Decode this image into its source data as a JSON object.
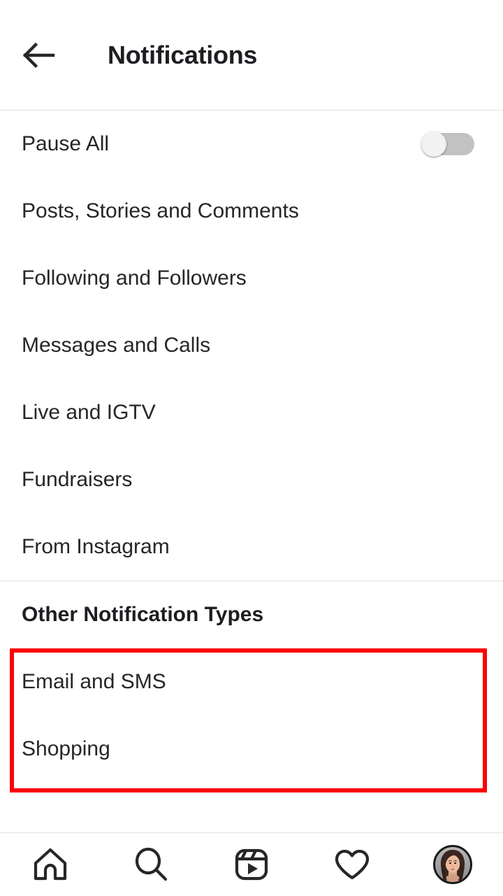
{
  "header": {
    "back_icon": "arrow-left-icon",
    "title": "Notifications"
  },
  "main_section": {
    "items": [
      {
        "label": "Pause All",
        "control": "toggle",
        "toggle_state": "off"
      },
      {
        "label": "Posts, Stories and Comments",
        "control": "none"
      },
      {
        "label": "Following and Followers",
        "control": "none"
      },
      {
        "label": "Messages and Calls",
        "control": "none"
      },
      {
        "label": "Live and IGTV",
        "control": "none"
      },
      {
        "label": "Fundraisers",
        "control": "none"
      },
      {
        "label": "From Instagram",
        "control": "none"
      }
    ]
  },
  "other_section": {
    "heading": "Other Notification Types",
    "items": [
      {
        "label": "Email and SMS"
      },
      {
        "label": "Shopping"
      }
    ]
  },
  "annotation": {
    "type": "highlight-rectangle",
    "color": "#fb0007"
  },
  "bottom_nav": {
    "items": [
      {
        "icon": "home-icon",
        "name": "home"
      },
      {
        "icon": "search-icon",
        "name": "search"
      },
      {
        "icon": "reels-icon",
        "name": "reels"
      },
      {
        "icon": "heart-icon",
        "name": "activity"
      },
      {
        "icon": "profile-avatar",
        "name": "profile"
      }
    ]
  },
  "colors": {
    "text_primary": "#262626",
    "text_title": "#1c1e21",
    "divider": "#e3e3e3",
    "toggle_track_off": "#c2c2c2",
    "toggle_knob": "#f2f2f2",
    "annotation_red": "#fb0007",
    "background": "#ffffff"
  }
}
